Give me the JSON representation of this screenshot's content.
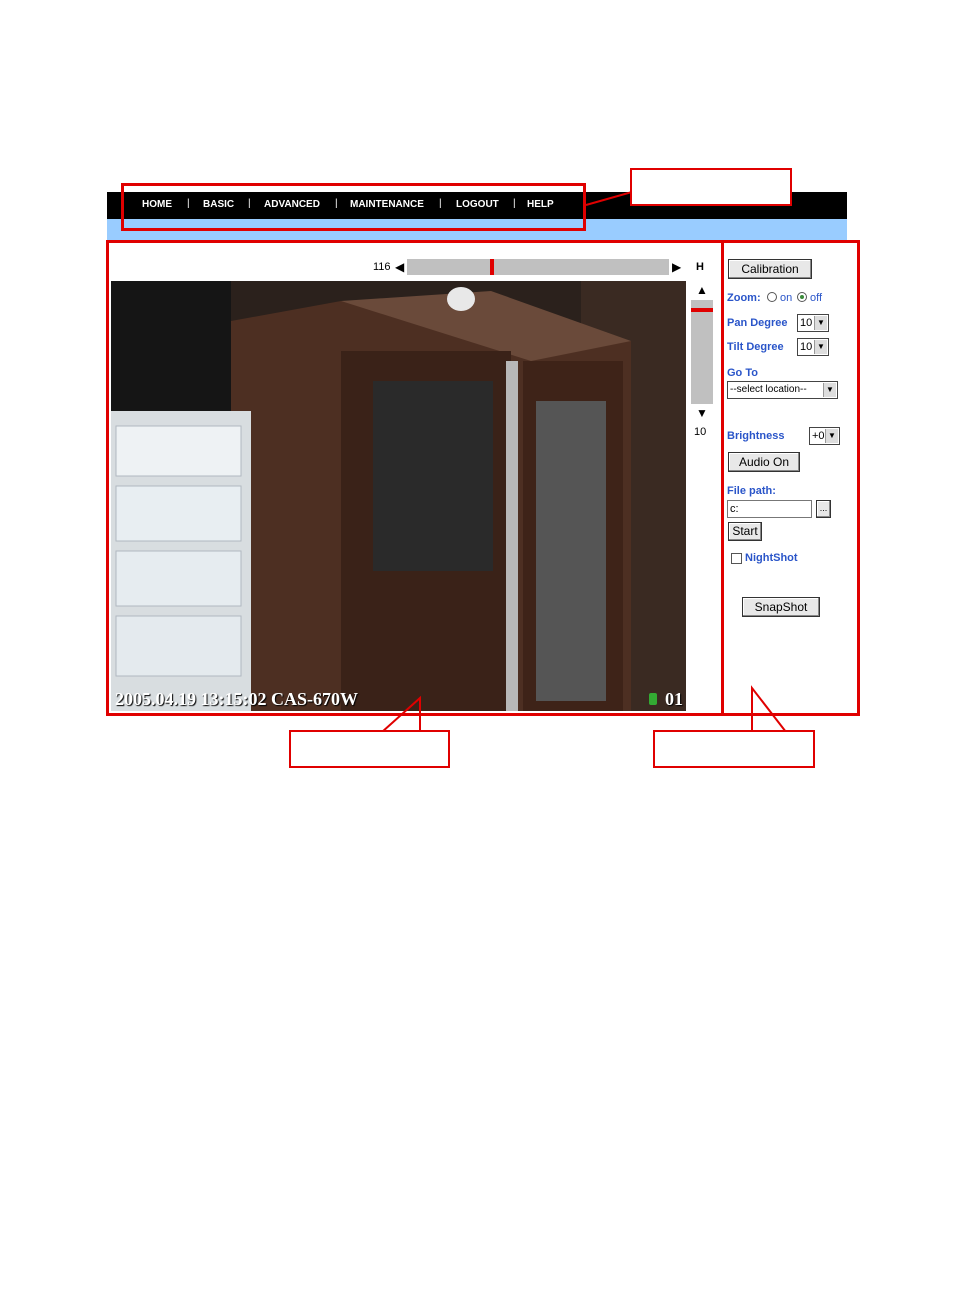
{
  "nav": {
    "items": [
      "HOME",
      "BASIC",
      "ADVANCED",
      "MAINTENANCE",
      "LOGOUT",
      "HELP"
    ],
    "separator": "|"
  },
  "pan": {
    "value": "116",
    "left_arrow": "◀",
    "right_arrow": "▶",
    "home_label": "H"
  },
  "tilt": {
    "value": "10",
    "up_arrow": "▲",
    "down_arrow": "▼"
  },
  "video": {
    "timestamp": "2005.04.19 13:15:02 CAS-670W",
    "channel": "01"
  },
  "controls": {
    "calibration": "Calibration",
    "zoom_label": "Zoom:",
    "zoom_on": "on",
    "zoom_off": "off",
    "pan_degree_label": "Pan Degree",
    "pan_degree_value": "10",
    "tilt_degree_label": "Tilt Degree",
    "tilt_degree_value": "10",
    "goto_label": "Go To",
    "goto_value": "--select location--",
    "brightness_label": "Brightness",
    "brightness_value": "+0",
    "audio_button": "Audio On",
    "file_path_label": "File path:",
    "file_path_value": "c:",
    "browse_button": "...",
    "start_button": "Start",
    "nightshot_label": "NightShot",
    "snapshot_button": "SnapShot"
  },
  "colors": {
    "annotation_red": "#e00000",
    "nav_bg": "#000000",
    "sub_bar": "#99ccff",
    "label_blue": "#2a55c9"
  }
}
